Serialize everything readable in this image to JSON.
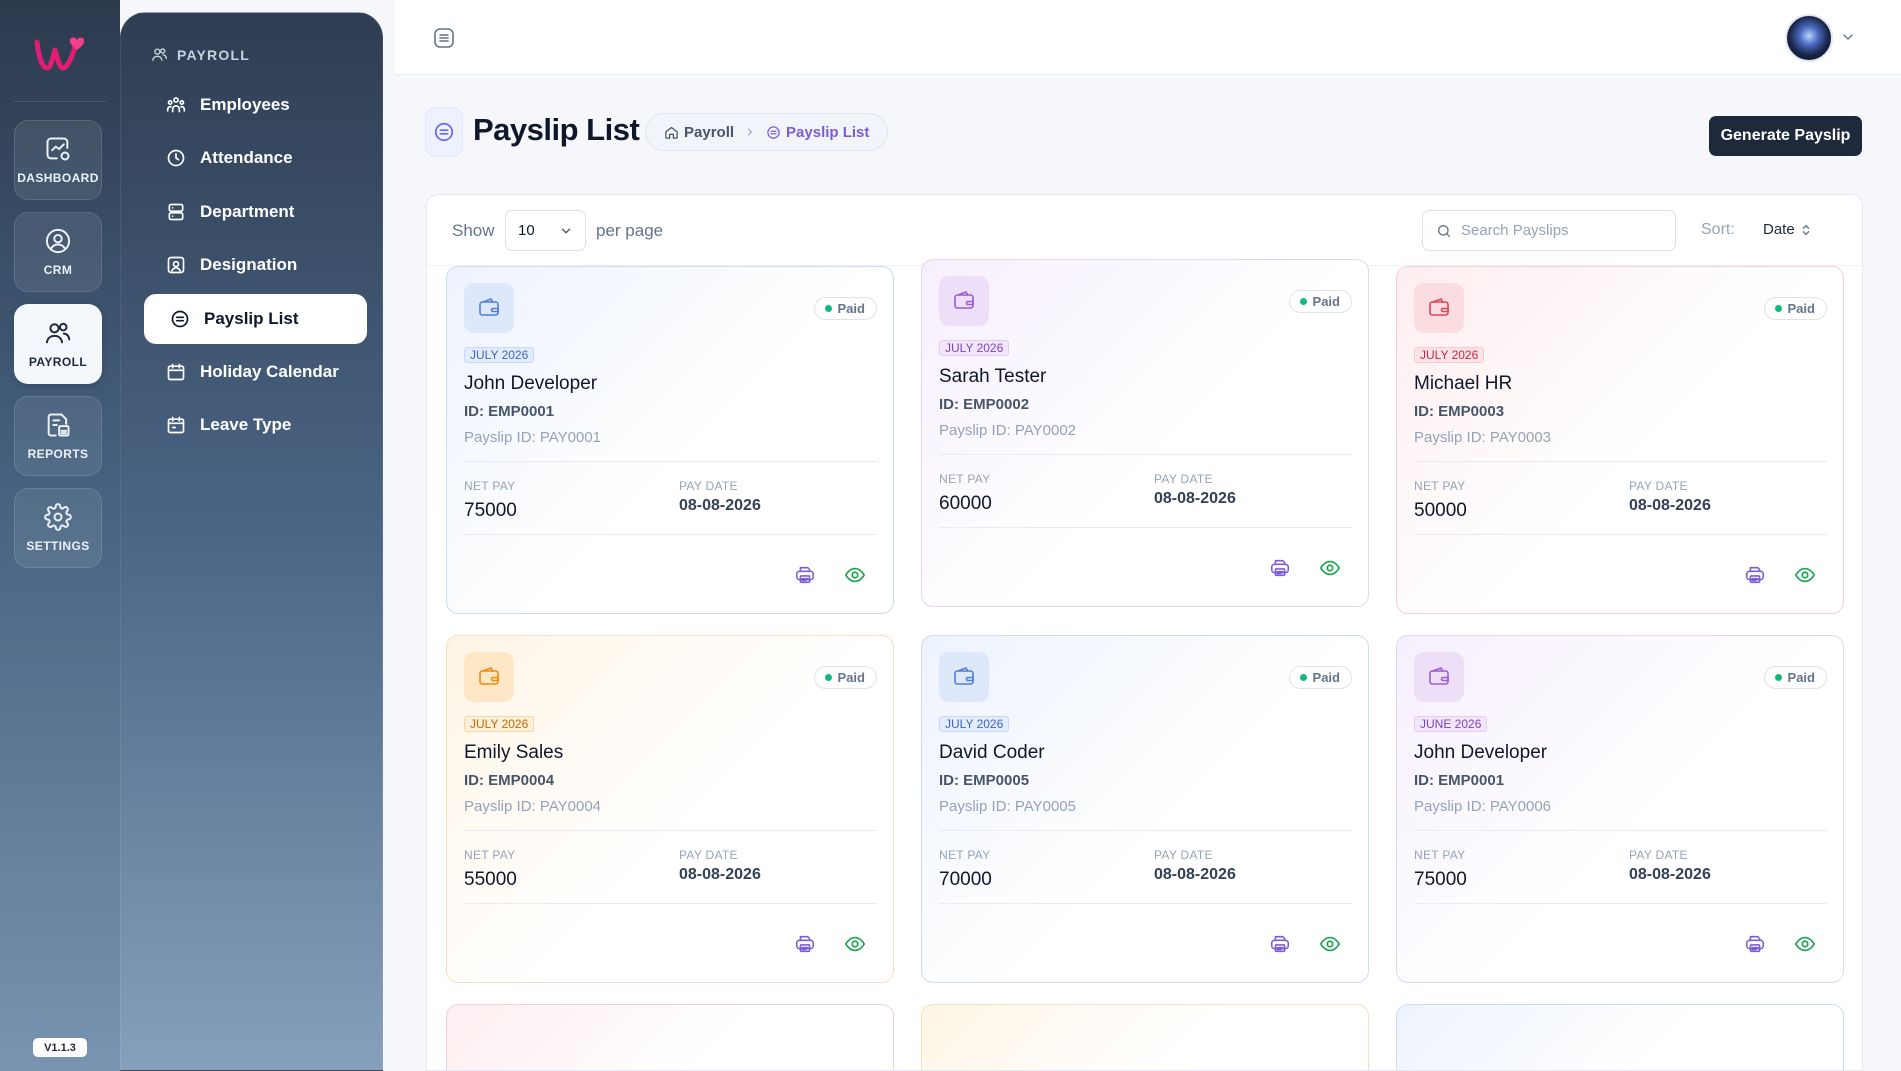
{
  "rail": {
    "items": [
      {
        "label": "DASHBOARD",
        "icon": "dashboard-icon"
      },
      {
        "label": "CRM",
        "icon": "user-circle-icon"
      },
      {
        "label": "PAYROLL",
        "icon": "users-icon"
      },
      {
        "label": "REPORTS",
        "icon": "reports-icon"
      },
      {
        "label": "SETTINGS",
        "icon": "gear-icon"
      }
    ],
    "active": "PAYROLL",
    "version": "V1.1.3"
  },
  "submenu": {
    "heading": "PAYROLL",
    "items": [
      {
        "label": "Employees",
        "icon": "employees-icon"
      },
      {
        "label": "Attendance",
        "icon": "clock-icon"
      },
      {
        "label": "Department",
        "icon": "department-icon"
      },
      {
        "label": "Designation",
        "icon": "designation-icon"
      },
      {
        "label": "Payslip List",
        "icon": "payslip-icon"
      },
      {
        "label": "Holiday Calendar",
        "icon": "calendar-icon"
      },
      {
        "label": "Leave Type",
        "icon": "leave-calendar-icon"
      }
    ],
    "active": "Payslip List"
  },
  "header": {
    "title": "Payslip List",
    "breadcrumb": [
      "Payroll",
      "Payslip List"
    ],
    "generate_label": "Generate Payslip"
  },
  "toolbar": {
    "show_label": "Show",
    "per_page_value": "10",
    "per_page_label": "per page",
    "search_placeholder": "Search Payslips",
    "sort_label": "Sort:",
    "sort_value": "Date"
  },
  "card_labels": {
    "net_pay": "NET PAY",
    "pay_date": "PAY DATE"
  },
  "colors": {
    "accent_dark": "#1e293b",
    "paid_dot": "#10b981",
    "print_icon": "#7c5cd6",
    "view_icon": "#16a34a"
  },
  "payslips": [
    {
      "theme": "blue",
      "status": "Paid",
      "period": "JULY 2026",
      "name": "John Developer",
      "emp_id": "ID: EMP0001",
      "payslip_id": "Payslip ID: PAY0001",
      "net_pay": "75000",
      "pay_date": "08-08-2026"
    },
    {
      "theme": "purple",
      "status": "Paid",
      "period": "JULY 2026",
      "name": "Sarah Tester",
      "emp_id": "ID: EMP0002",
      "payslip_id": "Payslip ID: PAY0002",
      "net_pay": "60000",
      "pay_date": "08-08-2026"
    },
    {
      "theme": "red",
      "status": "Paid",
      "period": "JULY 2026",
      "name": "Michael HR",
      "emp_id": "ID: EMP0003",
      "payslip_id": "Payslip ID: PAY0003",
      "net_pay": "50000",
      "pay_date": "08-08-2026"
    },
    {
      "theme": "orange",
      "status": "Paid",
      "period": "JULY 2026",
      "name": "Emily Sales",
      "emp_id": "ID: EMP0004",
      "payslip_id": "Payslip ID: PAY0004",
      "net_pay": "55000",
      "pay_date": "08-08-2026"
    },
    {
      "theme": "blue",
      "status": "Paid",
      "period": "JULY 2026",
      "name": "David Coder",
      "emp_id": "ID: EMP0005",
      "payslip_id": "Payslip ID: PAY0005",
      "net_pay": "70000",
      "pay_date": "08-08-2026"
    },
    {
      "theme": "purple",
      "status": "Paid",
      "period": "JUNE 2026",
      "name": "John Developer",
      "emp_id": "ID: EMP0001",
      "payslip_id": "Payslip ID: PAY0006",
      "net_pay": "75000",
      "pay_date": "08-08-2026"
    }
  ],
  "partial_next_row_themes": [
    "red",
    "orange",
    "blue"
  ]
}
